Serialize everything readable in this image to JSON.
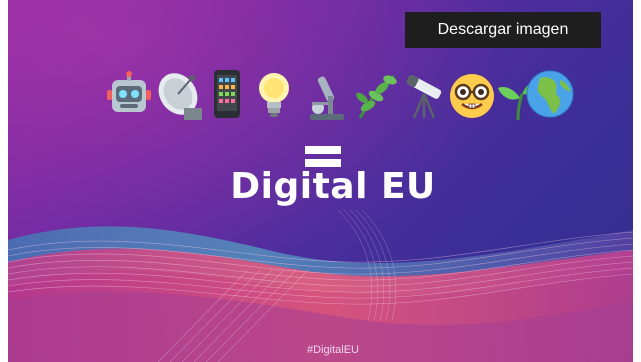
{
  "toolbar": {
    "download_label": "Descargar imagen"
  },
  "banner": {
    "emojis": [
      "robot-icon",
      "satellite-dish-icon",
      "mobile-phone-icon",
      "light-bulb-icon",
      "microscope-icon",
      "herb-icon",
      "telescope-icon",
      "nerd-face-icon",
      "seedling-icon",
      "globe-africa-europe-icon"
    ],
    "equals": "=",
    "title": "Digital EU",
    "hashtag": "#DigitalEU"
  },
  "colors": {
    "background_start": "#8a2aa6",
    "background_end": "#332c8c",
    "wave_pink": "#e0457a",
    "wave_teal": "#3fb7c4",
    "button_bg": "#1e1e1e"
  }
}
